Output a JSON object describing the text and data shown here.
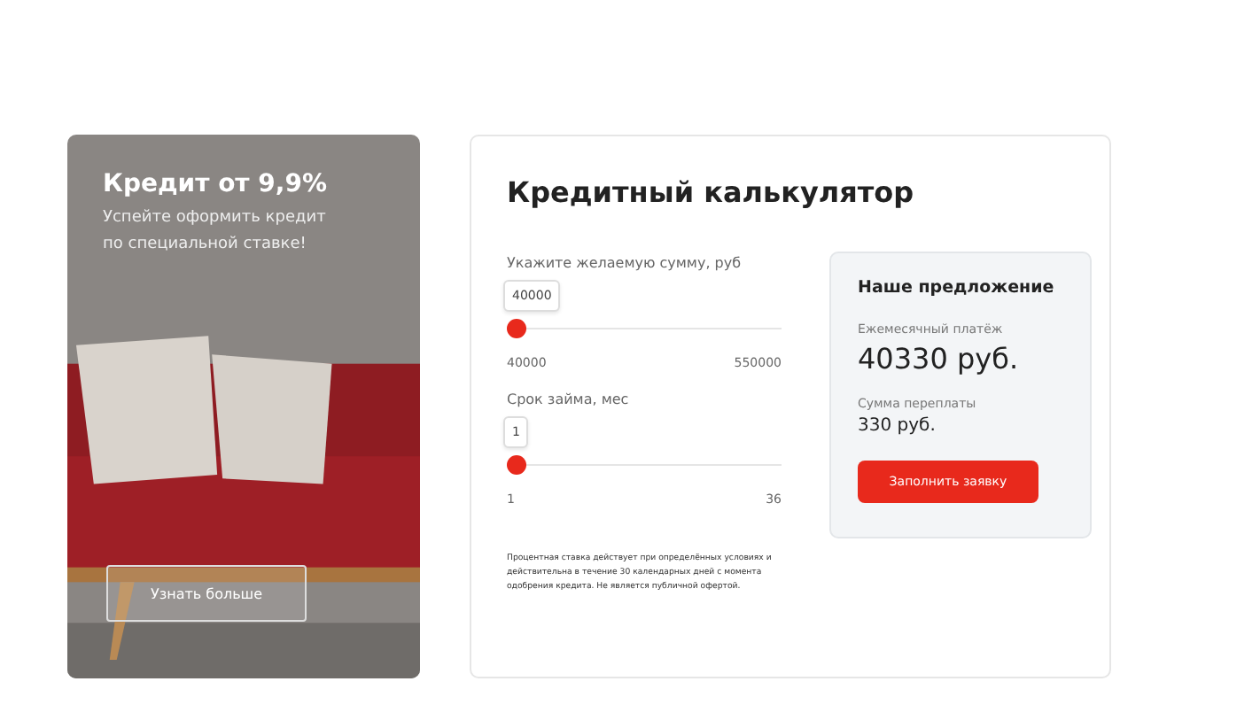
{
  "promo": {
    "title": "Кредит от 9,9%",
    "subtitle": "Успейте оформить кредит по специальной ставке!",
    "button": "Узнать больше"
  },
  "calculator": {
    "title": "Кредитный калькулятор",
    "sliders": [
      {
        "label": "Укажите желаемую сумму, руб",
        "value": "40000",
        "level": 0,
        "min": "40000",
        "max": "550000"
      },
      {
        "label": "Срок займа, мес",
        "value": "1",
        "level": 0,
        "min": "1",
        "max": "36"
      }
    ],
    "disclaimer": "Процентная ставка действует при определённых условиях и действительна в течение 30 календарных дней с момента одобрения кредита. Не является публичной офертой.",
    "offer": {
      "title": "Наше предложение",
      "monthly_label": "Ежемесячный платёж",
      "monthly_value": "40330 руб.",
      "overpay_label": "Сумма переплаты",
      "overpay_value": "330 руб.",
      "button": "Заполнить заявку"
    }
  }
}
